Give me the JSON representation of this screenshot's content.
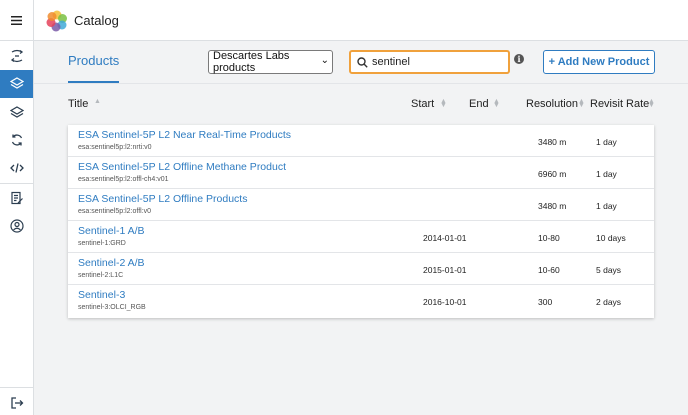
{
  "app": {
    "title": "Catalog"
  },
  "sidebar": {
    "items": [
      {
        "icon": "collapse-arrows-icon"
      },
      {
        "icon": "layers-icon",
        "active": true
      },
      {
        "icon": "layers-outline-icon"
      },
      {
        "icon": "refresh-icon"
      },
      {
        "icon": "code-icon"
      },
      {
        "icon": "edit-document-icon"
      },
      {
        "icon": "account-icon"
      },
      {
        "icon": "logout-icon"
      }
    ]
  },
  "header": {
    "tab_label": "Products",
    "org_select_value": "Descartes Labs products",
    "search_value": "sentinel",
    "info_glyph": "i",
    "add_button_label": "+ Add New Product"
  },
  "table": {
    "columns": {
      "title": "Title",
      "start": "Start",
      "end": "End",
      "resolution": "Resolution",
      "revisit": "Revisit Rate"
    },
    "rows": [
      {
        "title": "ESA Sentinel-5P L2 Near Real-Time Products",
        "id": "esa:sentinel5p:l2:nrti:v0",
        "start": "",
        "resolution": "3480 m",
        "revisit": "1 day"
      },
      {
        "title": "ESA Sentinel-5P L2 Offline Methane Product",
        "id": "esa:sentinel5p:l2:offl-ch4:v01",
        "start": "",
        "resolution": "6960 m",
        "revisit": "1 day"
      },
      {
        "title": "ESA Sentinel-5P L2 Offline Products",
        "id": "esa:sentinel5p:l2:offl:v0",
        "start": "",
        "resolution": "3480 m",
        "revisit": "1 day"
      },
      {
        "title": "Sentinel-1 A/B",
        "id": "sentinel-1:GRD",
        "start": "2014-01-01",
        "resolution": "10-80",
        "revisit": "10 days"
      },
      {
        "title": "Sentinel-2 A/B",
        "id": "sentinel-2:L1C",
        "start": "2015-01-01",
        "resolution": "10-60",
        "revisit": "5 days"
      },
      {
        "title": "Sentinel-3",
        "id": "sentinel-3:OLCI_RGB",
        "start": "2016-10-01",
        "resolution": "300",
        "revisit": "2 days"
      }
    ]
  },
  "colors": {
    "accent": "#2f7cc1",
    "search_border": "#f0a13c"
  }
}
